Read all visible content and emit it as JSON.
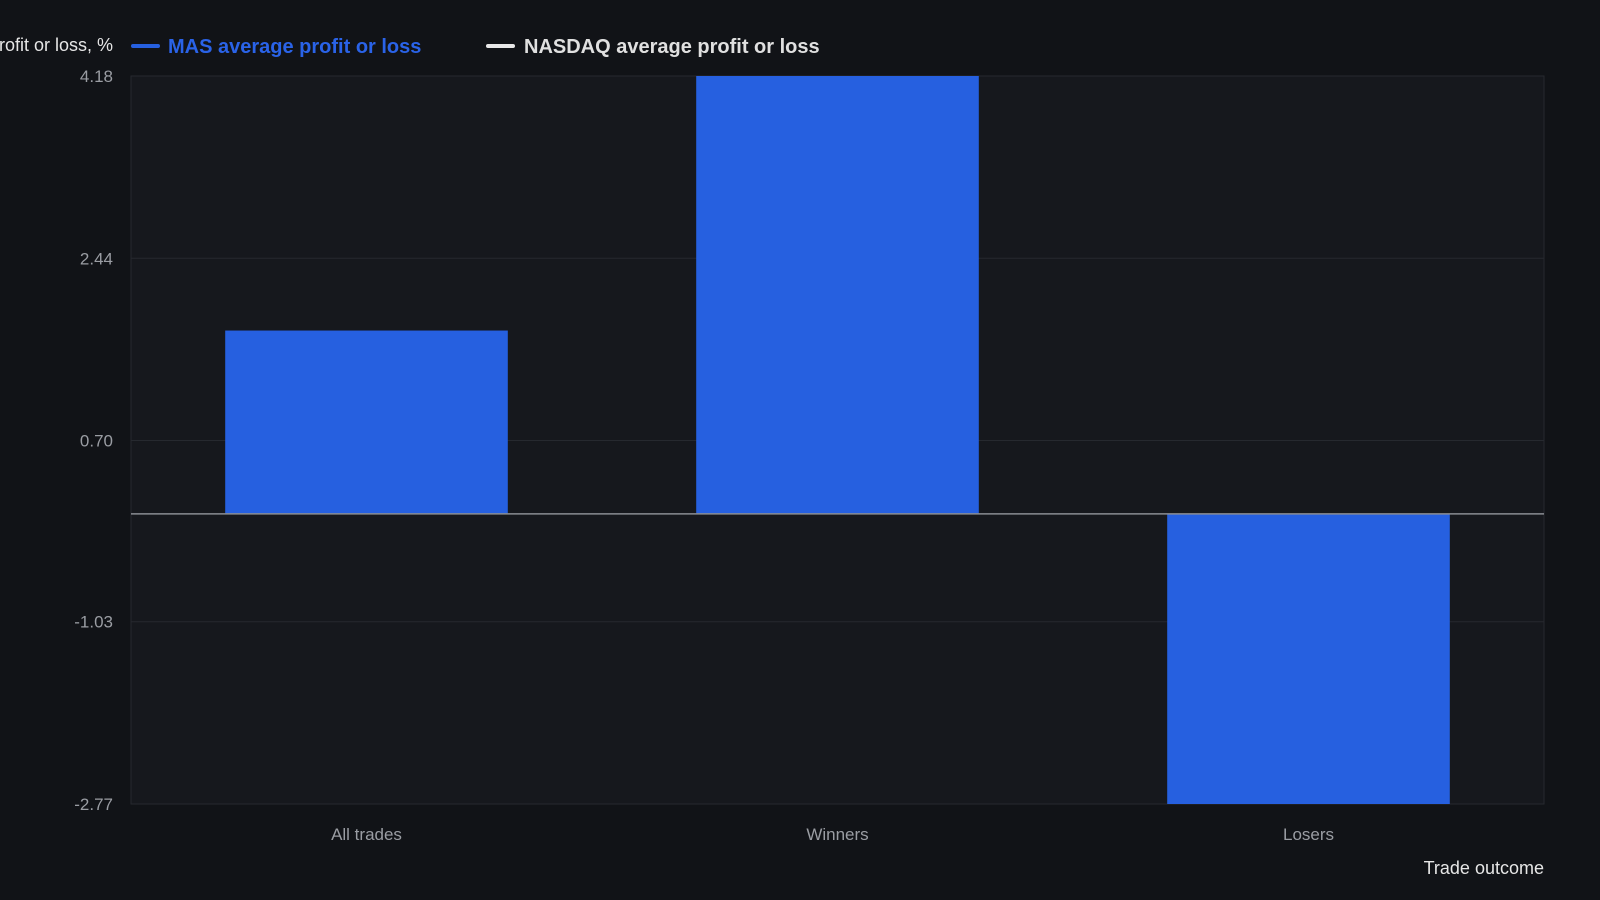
{
  "chart_data": {
    "type": "bar",
    "ylabel": "Average profit or loss, %",
    "xlabel": "Trade outcome",
    "categories": [
      "All trades",
      "Winners",
      "Losers"
    ],
    "series": [
      {
        "name": "MAS average profit or loss",
        "color": "#2660e0",
        "values": [
          1.75,
          4.18,
          -2.77
        ]
      },
      {
        "name": "NASDAQ average profit or loss",
        "color": "#e8e8e8",
        "values": []
      }
    ],
    "ylim": [
      -2.77,
      4.18
    ],
    "yticks": [
      "4.18",
      "2.44",
      "0.70",
      "-1.03",
      "-2.77"
    ],
    "legend_position": "top",
    "grid": true
  },
  "colors": {
    "background": "#111317",
    "plot_background": "#16181d",
    "grid": "#26292f",
    "zero_line": "#8a8d93",
    "tick_text": "#9a9da3",
    "axis_text": "#d8d8d8",
    "legend_mas_text": "#2a63e8",
    "legend_nasdaq_text": "#e0e0e0"
  }
}
